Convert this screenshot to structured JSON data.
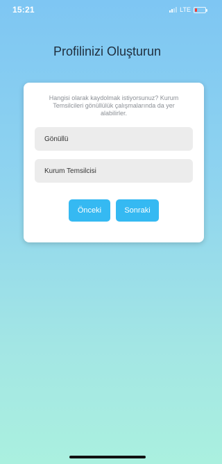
{
  "status_bar": {
    "time": "15:21",
    "network": "LTE",
    "battery_color": "#ff3b30"
  },
  "page": {
    "title": "Profilinizi Oluşturun"
  },
  "card": {
    "question": "Hangisi olarak kaydolmak istiyorsunuz? Kurum Temsilcileri gönüllülük çalışmalarında da yer alabilirler.",
    "options": [
      {
        "label": "Gönüllü"
      },
      {
        "label": "Kurum Temsilcisi"
      }
    ],
    "prev_label": "Önceki",
    "next_label": "Sonraki"
  },
  "colors": {
    "accent": "#35b9f2",
    "gradient_top": "#7ec6f3",
    "gradient_bottom": "#aaf0df"
  }
}
